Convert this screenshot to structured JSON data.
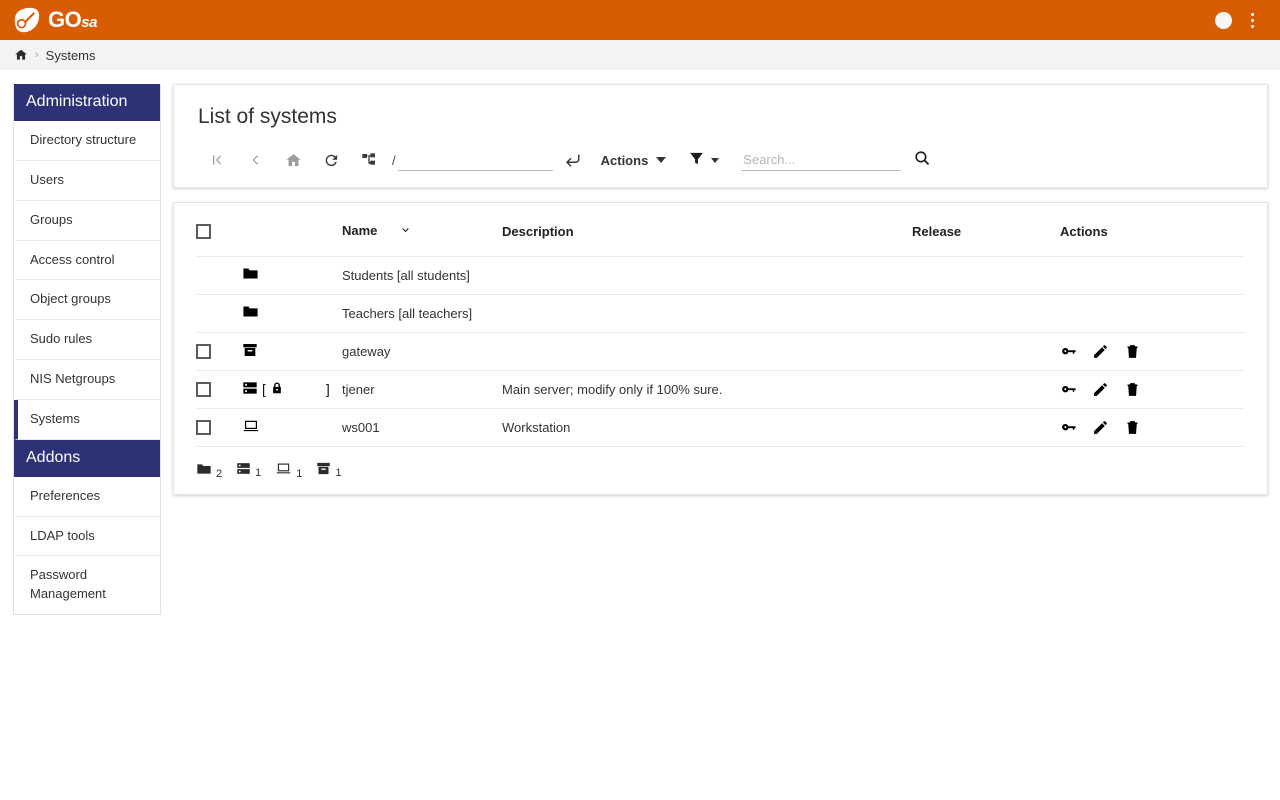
{
  "topbar": {
    "logo_text_main": "GO",
    "logo_text_sub": "sa",
    "logo_icon": "shuttlecock-shield-icon",
    "avatar_icon": "user-avatar-icon",
    "menu_icon": "kebab-menu-icon",
    "bg_color": "#d85c04"
  },
  "breadcrumb": {
    "home_icon": "home-icon",
    "separator": "›",
    "current": "Systems"
  },
  "sidebar": {
    "sections": [
      {
        "title": "Administration",
        "items": [
          {
            "label": "Directory structure",
            "active": false
          },
          {
            "label": "Users",
            "active": false
          },
          {
            "label": "Groups",
            "active": false
          },
          {
            "label": "Access control",
            "active": false
          },
          {
            "label": "Object groups",
            "active": false
          },
          {
            "label": "Sudo rules",
            "active": false
          },
          {
            "label": "NIS Netgroups",
            "active": false
          },
          {
            "label": "Systems",
            "active": true
          }
        ]
      },
      {
        "title": "Addons",
        "items": [
          {
            "label": "Preferences",
            "active": false
          },
          {
            "label": "LDAP tools",
            "active": false
          },
          {
            "label": "Password Management",
            "active": false
          }
        ]
      }
    ],
    "header_color": "#2d3277"
  },
  "main": {
    "title": "List of systems",
    "toolbar": {
      "first_page_icon": "first-page-icon",
      "back_icon": "chevron-left-icon",
      "home_icon": "home-icon",
      "reload_icon": "reload-icon",
      "tree_icon": "sitemap-tree-icon",
      "path_prefix": "/",
      "path_value": "",
      "path_placeholder": "",
      "submit_icon": "enter-arrow-icon",
      "actions_label": "Actions",
      "actions_caret_icon": "caret-down-icon",
      "filter_icon": "filter-funnel-icon",
      "filter_caret_icon": "caret-down-icon",
      "search_value": "",
      "search_placeholder": "Search...",
      "search_icon": "magnifier-icon"
    },
    "table": {
      "columns": {
        "select": "",
        "icon": "",
        "name": "Name",
        "description": "Description",
        "release": "Release",
        "actions": "Actions"
      },
      "sort_icon": "chevron-down-icon",
      "rows": [
        {
          "selectable": false,
          "checked": false,
          "icons": [
            "folder-icon"
          ],
          "locked": false,
          "name": "Students [all students]",
          "description": "",
          "release": "",
          "actions": []
        },
        {
          "selectable": false,
          "checked": false,
          "icons": [
            "folder-icon"
          ],
          "locked": false,
          "name": "Teachers [all teachers]",
          "description": "",
          "release": "",
          "actions": []
        },
        {
          "selectable": true,
          "checked": false,
          "icons": [
            "archive-box-icon"
          ],
          "locked": false,
          "name": "gateway",
          "description": "",
          "release": "",
          "actions": [
            "key-icon",
            "pencil-icon",
            "trash-icon"
          ]
        },
        {
          "selectable": true,
          "checked": false,
          "icons": [
            "server-rack-icon"
          ],
          "locked": true,
          "lock_open": "[",
          "lock_icon": "padlock-icon",
          "lock_close": "]",
          "name": "tjener",
          "description": "Main server; modify only if 100% sure.",
          "release": "",
          "actions": [
            "key-icon",
            "pencil-icon",
            "trash-icon"
          ]
        },
        {
          "selectable": true,
          "checked": false,
          "icons": [
            "laptop-icon"
          ],
          "locked": false,
          "name": "ws001",
          "description": "Workstation",
          "release": "",
          "actions": [
            "key-icon",
            "pencil-icon",
            "trash-icon"
          ]
        }
      ],
      "legend": [
        {
          "icon": "folder-icon",
          "count": "2"
        },
        {
          "icon": "server-rack-icon",
          "count": "1"
        },
        {
          "icon": "laptop-icon",
          "count": "1"
        },
        {
          "icon": "archive-box-icon",
          "count": "1"
        }
      ]
    }
  }
}
